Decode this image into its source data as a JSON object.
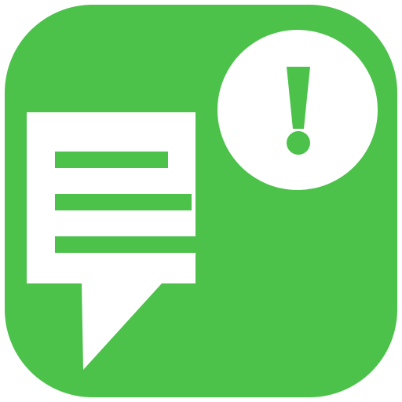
{
  "icon": {
    "name": "chat-alert-app-icon",
    "colors": {
      "background": "#4cc24a",
      "foreground": "#ffffff",
      "accent": "#4cc24a"
    },
    "glyphs": {
      "speech_bubble": "speech-bubble-icon",
      "text_lines": "text-lines-icon",
      "alert_badge": "exclamation-badge-icon"
    },
    "text_line_count": 3
  }
}
